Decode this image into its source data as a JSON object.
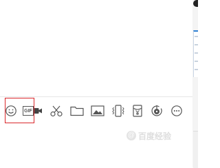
{
  "toolbar": {
    "gif_label": "GIF",
    "items": [
      {
        "name": "emoji-button",
        "icon": "smiley-icon"
      },
      {
        "name": "gif-button",
        "icon": "gif-icon"
      },
      {
        "name": "video-button",
        "icon": "video-camera-icon"
      },
      {
        "name": "screenshot-button",
        "icon": "scissors-icon"
      },
      {
        "name": "send-file-button",
        "icon": "folder-icon"
      },
      {
        "name": "send-image-button",
        "icon": "image-icon"
      },
      {
        "name": "shake-window-button",
        "icon": "phone-vibrate-icon"
      },
      {
        "name": "red-packet-button",
        "icon": "red-packet-icon"
      },
      {
        "name": "music-button",
        "icon": "music-disc-icon"
      },
      {
        "name": "more-button",
        "icon": "more-dots-icon"
      }
    ]
  },
  "watermark": {
    "logo": "@",
    "text": "百度经验"
  },
  "colors": {
    "icon": "#555555",
    "highlight": "#d9262a",
    "accent": "#2d7fd3"
  }
}
